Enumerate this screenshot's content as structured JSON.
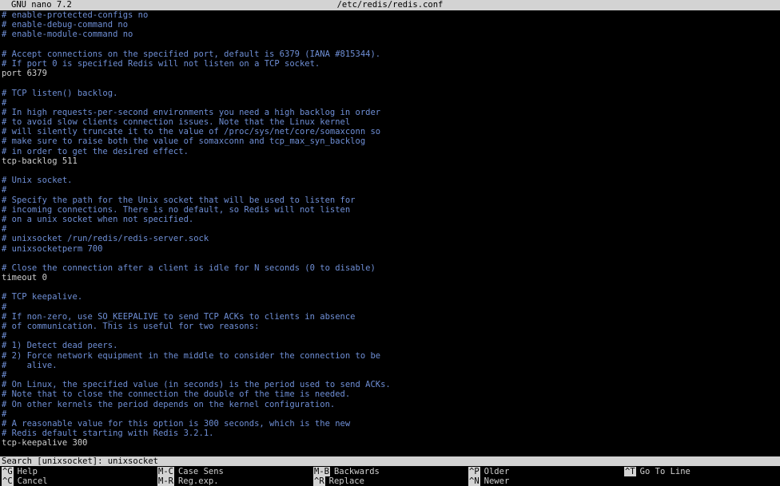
{
  "titlebar": {
    "app": "GNU nano 7.2",
    "file": "/etc/redis/redis.conf"
  },
  "lines": [
    {
      "type": "comment",
      "text": "# enable-protected-configs no"
    },
    {
      "type": "comment",
      "text": "# enable-debug-command no"
    },
    {
      "type": "comment",
      "text": "# enable-module-command no"
    },
    {
      "type": "blank",
      "text": ""
    },
    {
      "type": "comment",
      "text": "# Accept connections on the specified port, default is 6379 (IANA #815344)."
    },
    {
      "type": "comment",
      "text": "# If port 0 is specified Redis will not listen on a TCP socket."
    },
    {
      "type": "code",
      "text": "port 6379"
    },
    {
      "type": "blank",
      "text": ""
    },
    {
      "type": "comment",
      "text": "# TCP listen() backlog."
    },
    {
      "type": "comment",
      "text": "#"
    },
    {
      "type": "comment",
      "text": "# In high requests-per-second environments you need a high backlog in order"
    },
    {
      "type": "comment",
      "text": "# to avoid slow clients connection issues. Note that the Linux kernel"
    },
    {
      "type": "comment",
      "text": "# will silently truncate it to the value of /proc/sys/net/core/somaxconn so"
    },
    {
      "type": "comment",
      "text": "# make sure to raise both the value of somaxconn and tcp_max_syn_backlog"
    },
    {
      "type": "comment",
      "text": "# in order to get the desired effect."
    },
    {
      "type": "code",
      "text": "tcp-backlog 511"
    },
    {
      "type": "blank",
      "text": ""
    },
    {
      "type": "comment",
      "text": "# Unix socket."
    },
    {
      "type": "comment",
      "text": "#"
    },
    {
      "type": "comment",
      "text": "# Specify the path for the Unix socket that will be used to listen for"
    },
    {
      "type": "comment",
      "text": "# incoming connections. There is no default, so Redis will not listen"
    },
    {
      "type": "comment",
      "text": "# on a unix socket when not specified."
    },
    {
      "type": "comment",
      "text": "#"
    },
    {
      "type": "comment",
      "text": "# unixsocket /run/redis/redis-server.sock"
    },
    {
      "type": "comment",
      "text": "# unixsocketperm 700"
    },
    {
      "type": "blank",
      "text": ""
    },
    {
      "type": "comment",
      "text": "# Close the connection after a client is idle for N seconds (0 to disable)"
    },
    {
      "type": "code",
      "text": "timeout 0"
    },
    {
      "type": "blank",
      "text": ""
    },
    {
      "type": "comment",
      "text": "# TCP keepalive."
    },
    {
      "type": "comment",
      "text": "#"
    },
    {
      "type": "comment",
      "text": "# If non-zero, use SO_KEEPALIVE to send TCP ACKs to clients in absence"
    },
    {
      "type": "comment",
      "text": "# of communication. This is useful for two reasons:"
    },
    {
      "type": "comment",
      "text": "#"
    },
    {
      "type": "comment",
      "text": "# 1) Detect dead peers."
    },
    {
      "type": "comment",
      "text": "# 2) Force network equipment in the middle to consider the connection to be"
    },
    {
      "type": "comment",
      "text": "#    alive."
    },
    {
      "type": "comment",
      "text": "#"
    },
    {
      "type": "comment",
      "text": "# On Linux, the specified value (in seconds) is the period used to send ACKs."
    },
    {
      "type": "comment",
      "text": "# Note that to close the connection the double of the time is needed."
    },
    {
      "type": "comment",
      "text": "# On other kernels the period depends on the kernel configuration."
    },
    {
      "type": "comment",
      "text": "#"
    },
    {
      "type": "comment",
      "text": "# A reasonable value for this option is 300 seconds, which is the new"
    },
    {
      "type": "comment",
      "text": "# Redis default starting with Redis 3.2.1."
    },
    {
      "type": "code",
      "text": "tcp-keepalive 300"
    }
  ],
  "search": {
    "prompt": "Search [unixsocket]: ",
    "value": "unixsocket"
  },
  "shortcuts": {
    "row1": [
      {
        "key": "^G",
        "label": "Help"
      },
      {
        "key": "M-C",
        "label": "Case Sens"
      },
      {
        "key": "M-B",
        "label": "Backwards"
      },
      {
        "key": "^P",
        "label": "Older"
      },
      {
        "key": "^T",
        "label": "Go To Line"
      }
    ],
    "row2": [
      {
        "key": "^C",
        "label": "Cancel"
      },
      {
        "key": "M-R",
        "label": "Reg.exp."
      },
      {
        "key": "^R",
        "label": "Replace"
      },
      {
        "key": "^N",
        "label": "Newer"
      }
    ]
  },
  "colors": {
    "comment": "#6f8fd6",
    "code": "#cfcfcf",
    "bar_bg": "#d3d3d3",
    "background": "#000000"
  }
}
